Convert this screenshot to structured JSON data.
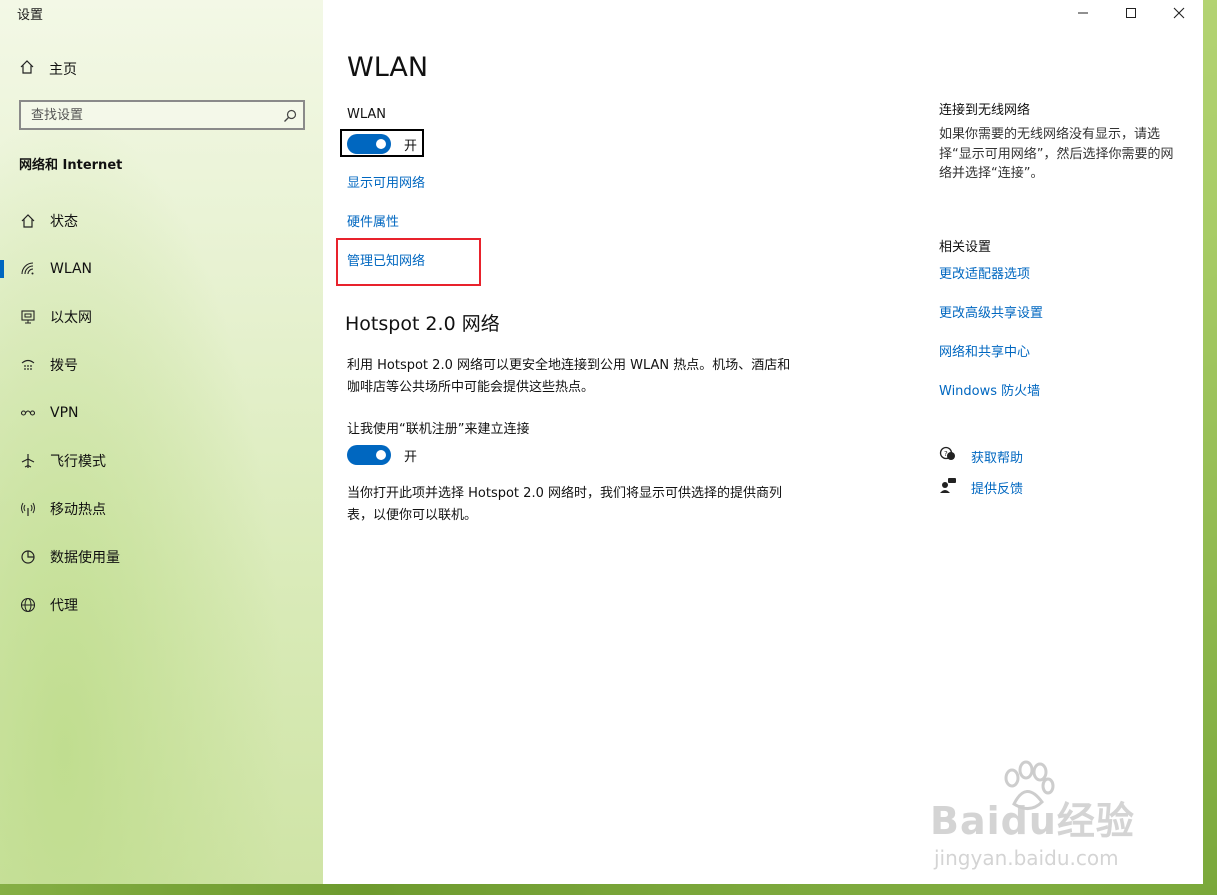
{
  "app": {
    "title": "设置"
  },
  "window_controls": {
    "minimize": "—",
    "maximize": "☐",
    "close": "✕"
  },
  "sidebar": {
    "home_label": "主页",
    "search_placeholder": "查找设置",
    "section_title": "网络和 Internet",
    "items": [
      {
        "label": "状态",
        "icon": "home-state-icon"
      },
      {
        "label": "WLAN",
        "icon": "wifi-icon",
        "active": true
      },
      {
        "label": "以太网",
        "icon": "ethernet-icon"
      },
      {
        "label": "拨号",
        "icon": "dialup-icon"
      },
      {
        "label": "VPN",
        "icon": "vpn-icon"
      },
      {
        "label": "飞行模式",
        "icon": "airplane-icon"
      },
      {
        "label": "移动热点",
        "icon": "hotspot-icon"
      },
      {
        "label": "数据使用量",
        "icon": "data-usage-icon"
      },
      {
        "label": "代理",
        "icon": "globe-icon"
      }
    ]
  },
  "main": {
    "title": "WLAN",
    "wlan_label": "WLAN",
    "wlan_toggle_state": "开",
    "links": {
      "show_available": "显示可用网络",
      "hardware": "硬件属性",
      "manage_known": "管理已知网络"
    },
    "hotspot": {
      "heading": "Hotspot 2.0 网络",
      "desc": "利用 Hotspot 2.0 网络可以更安全地连接到公用 WLAN 热点。机场、酒店和咖啡店等公共场所中可能会提供这些热点。",
      "toggle_label": "让我使用“联机注册”来建立连接",
      "toggle_state": "开",
      "note": "当你打开此项并选择 Hotspot 2.0 网络时，我们将显示可供选择的提供商列表，以便你可以联机。"
    }
  },
  "right": {
    "connect_title": "连接到无线网络",
    "connect_text": "如果你需要的无线网络没有显示，请选择“显示可用网络”，然后选择你需要的网络并选择“连接”。",
    "related_title": "相关设置",
    "related_links": [
      "更改适配器选项",
      "更改高级共享设置",
      "网络和共享中心",
      "Windows 防火墙"
    ],
    "help": "获取帮助",
    "feedback": "提供反馈"
  },
  "watermark": {
    "brand": "Baidu经验",
    "url": "jingyan.baidu.com"
  },
  "colors": {
    "accent": "#0067c0",
    "highlight": "#e8222c"
  }
}
